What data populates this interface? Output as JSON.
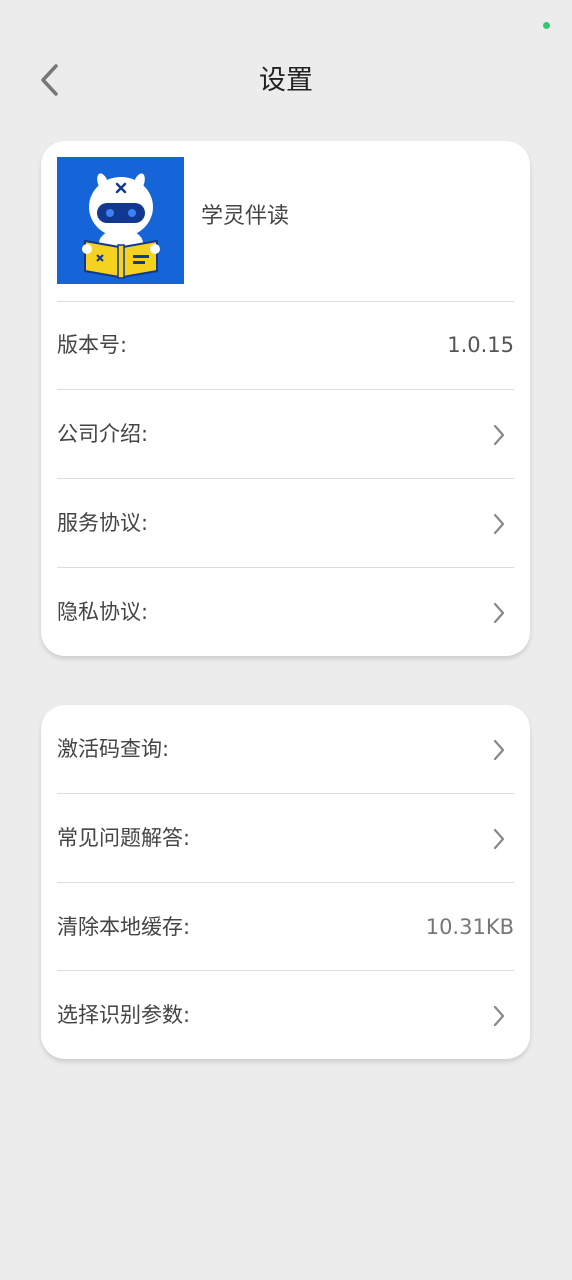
{
  "header": {
    "title": "设置",
    "back_icon": "chevron-left-icon"
  },
  "app": {
    "name": "学灵伴读",
    "logo_color": "#1565d8",
    "book_color": "#f5d21f"
  },
  "group1": {
    "version_label": "版本号:",
    "version_value": "1.0.15",
    "company_label": "公司介绍:",
    "service_label": "服务协议:",
    "privacy_label": "隐私协议:"
  },
  "group2": {
    "activation_label": "激活码查询:",
    "faq_label": "常见问题解答:",
    "cache_label": "清除本地缓存:",
    "cache_value": "10.31KB",
    "recognition_label": "选择识别参数:"
  },
  "colors": {
    "background": "#ececec",
    "card": "#ffffff",
    "status_dot": "#2ecc71"
  }
}
